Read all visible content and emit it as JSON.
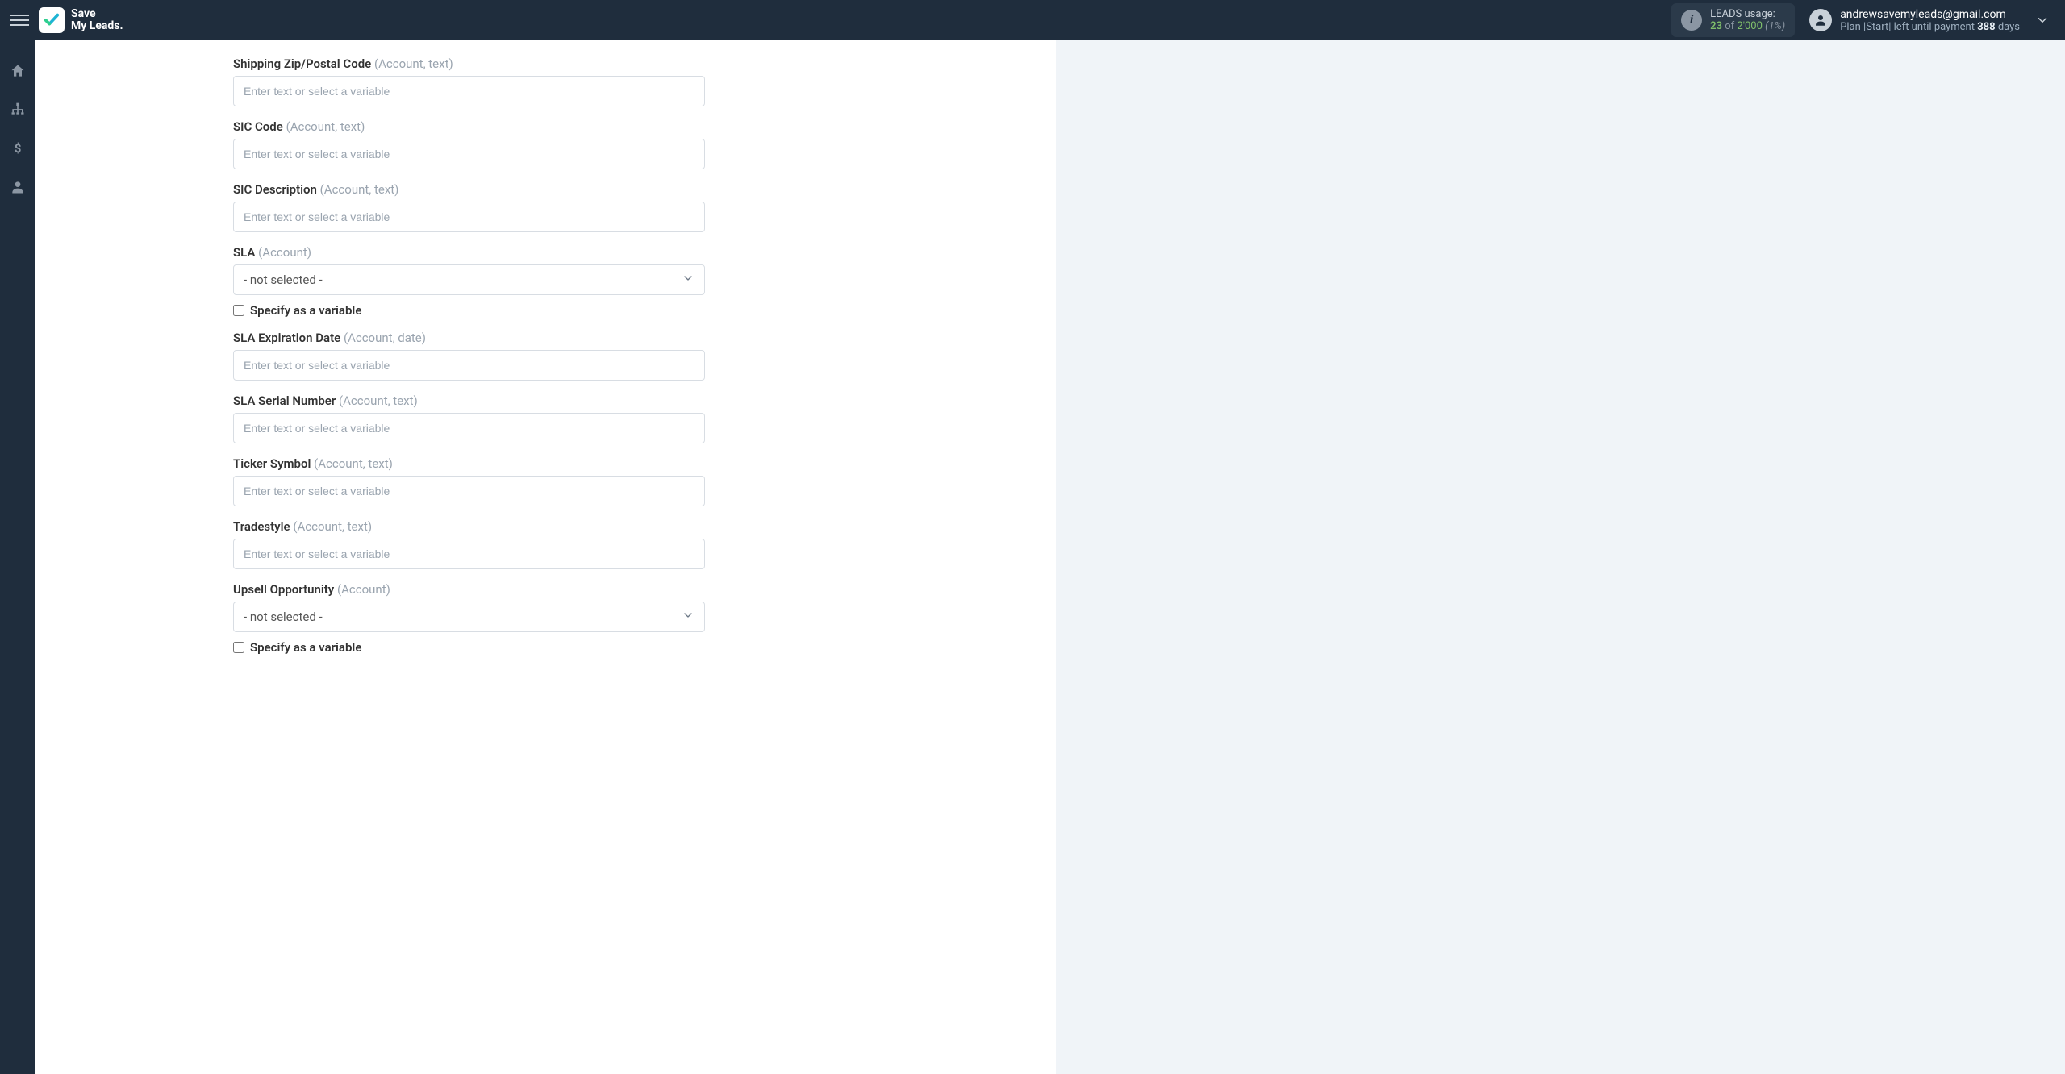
{
  "brand": {
    "line1": "Save",
    "line2": "My Leads."
  },
  "usage": {
    "label": "LEADS usage:",
    "used": "23",
    "of": "of",
    "total": "2'000",
    "pct": "(1%)"
  },
  "account": {
    "email": "andrewsavemyleads@gmail.com",
    "plan_prefix": "Plan |Start| left until payment ",
    "plan_days": "388",
    "plan_suffix": " days"
  },
  "form": {
    "placeholder": "Enter text or select a variable",
    "not_selected": "- not selected -",
    "specify_variable": "Specify as a variable",
    "fields": {
      "shipping_zip": {
        "label": "Shipping Zip/Postal Code",
        "meta": "(Account, text)"
      },
      "sic_code": {
        "label": "SIC Code",
        "meta": "(Account, text)"
      },
      "sic_desc": {
        "label": "SIC Description",
        "meta": "(Account, text)"
      },
      "sla": {
        "label": "SLA",
        "meta": "(Account)"
      },
      "sla_exp": {
        "label": "SLA Expiration Date",
        "meta": "(Account, date)"
      },
      "sla_serial": {
        "label": "SLA Serial Number",
        "meta": "(Account, text)"
      },
      "ticker": {
        "label": "Ticker Symbol",
        "meta": "(Account, text)"
      },
      "tradestyle": {
        "label": "Tradestyle",
        "meta": "(Account, text)"
      },
      "upsell": {
        "label": "Upsell Opportunity",
        "meta": "(Account)"
      }
    }
  }
}
